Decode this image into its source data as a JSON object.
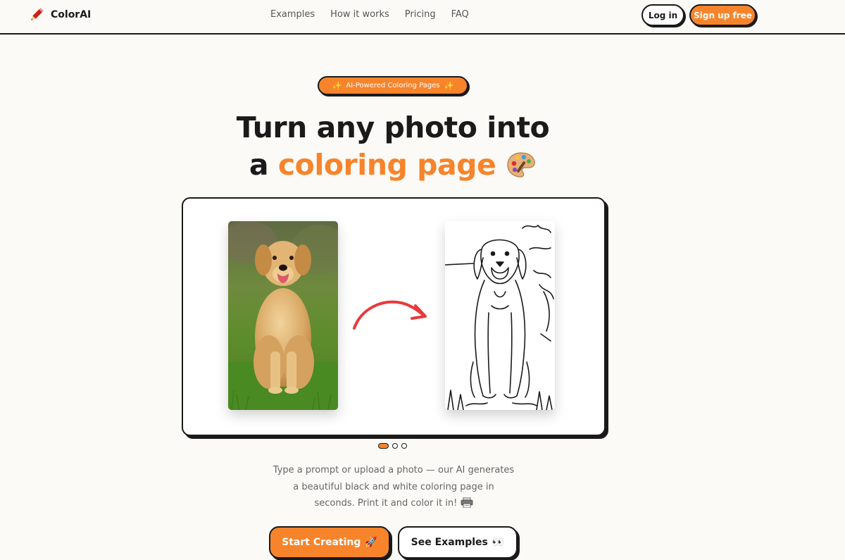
{
  "brand": {
    "name": "ColorAI",
    "logo_icon": "pencil-icon"
  },
  "nav": {
    "links": [
      "Examples",
      "How it works",
      "Pricing",
      "FAQ"
    ],
    "login_label": "Log in",
    "signup_label": "Sign up free"
  },
  "hero": {
    "badge": "AI-Powered Coloring Pages",
    "badge_icon": "sparkles-icon",
    "headline_line1": "Turn any photo into",
    "headline_prefix": "a",
    "headline_accent": "coloring page",
    "headline_icon": "palette-icon",
    "description": "Type a prompt or upload a photo — our AI generates a beautiful black and white coloring page in seconds. Print it and color it in!",
    "description_icon": "printer-icon",
    "cta_primary": "Start Creating",
    "cta_primary_icon": "rocket-icon",
    "cta_secondary": "See Examples",
    "cta_secondary_icon": "eyes-icon"
  },
  "carousel": {
    "slide_count": 3,
    "active_index": 0
  },
  "colors": {
    "accent": "#f7842b",
    "ink": "#1a1a1a",
    "background": "#fcfaf6"
  }
}
